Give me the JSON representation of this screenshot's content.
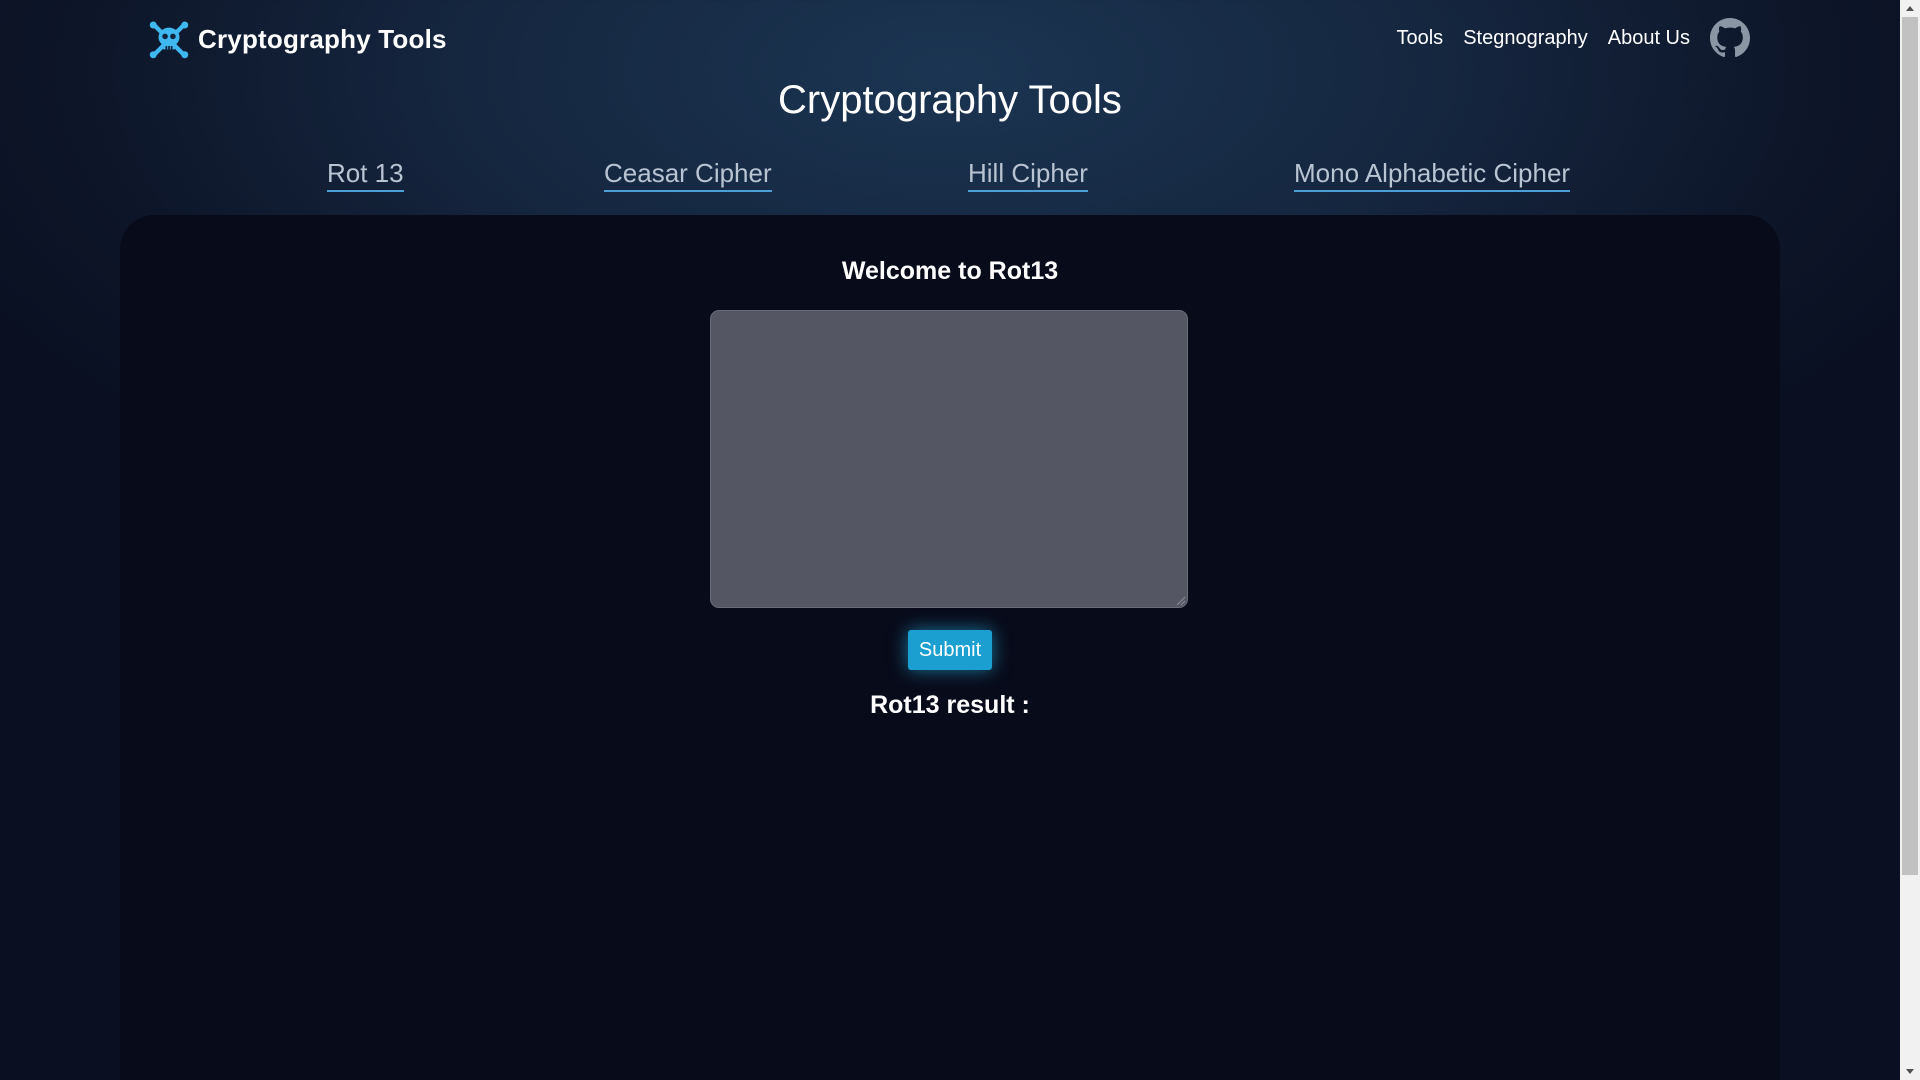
{
  "navbar": {
    "brand_label": "Cryptography Tools",
    "brand_icon": "skull-crossbones-icon",
    "links": [
      {
        "label": "Tools"
      },
      {
        "label": "Stegnography"
      },
      {
        "label": "About Us"
      }
    ],
    "github_icon": "github-icon"
  },
  "page": {
    "title": "Cryptography Tools"
  },
  "tabs": [
    {
      "label": "Rot 13"
    },
    {
      "label": "Ceasar Cipher"
    },
    {
      "label": "Hill Cipher"
    },
    {
      "label": "Mono Alphabetic Cipher"
    }
  ],
  "rot13": {
    "welcome": "Welcome to Rot13",
    "input_value": "",
    "submit_label": "Submit",
    "result_label": "Rot13 result :"
  },
  "colors": {
    "accent": "#1a9fd0",
    "panel_bg": "#080b1a",
    "textarea_bg": "#545663",
    "tab_text": "#b9c4d3",
    "tab_underline": "#4b9fd6",
    "brand_icon": "#3fb8f0"
  }
}
